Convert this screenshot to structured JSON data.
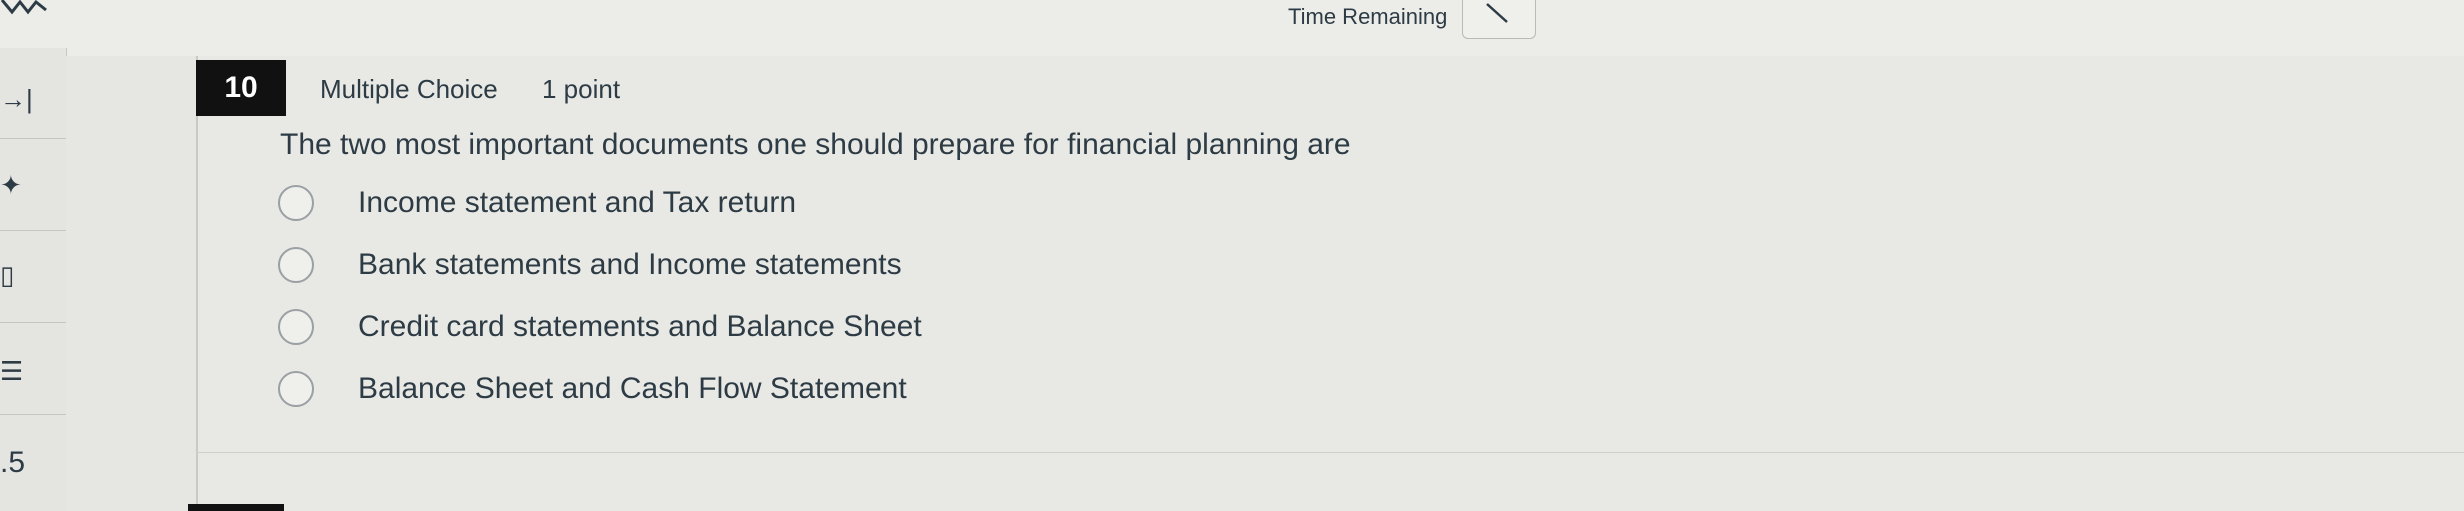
{
  "header": {
    "time_remaining_label": "Time Remaining"
  },
  "sidebar": {
    "items": [
      {
        "icon": "collapse-arrow-icon",
        "glyph": "→|"
      },
      {
        "icon": "pin-icon",
        "glyph": "✦"
      },
      {
        "icon": "bookmark-icon",
        "glyph": "▯"
      },
      {
        "icon": "list-icon",
        "glyph": "☰"
      }
    ],
    "number_fragment": ".5"
  },
  "question": {
    "number": "10",
    "type": "Multiple Choice",
    "points": "1 point",
    "text": "The two most important documents one should prepare for financial planning are",
    "options": [
      "Income statement and Tax return",
      "Bank statements and Income statements",
      "Credit card statements and Balance Sheet",
      "Balance Sheet and Cash Flow Statement"
    ]
  }
}
